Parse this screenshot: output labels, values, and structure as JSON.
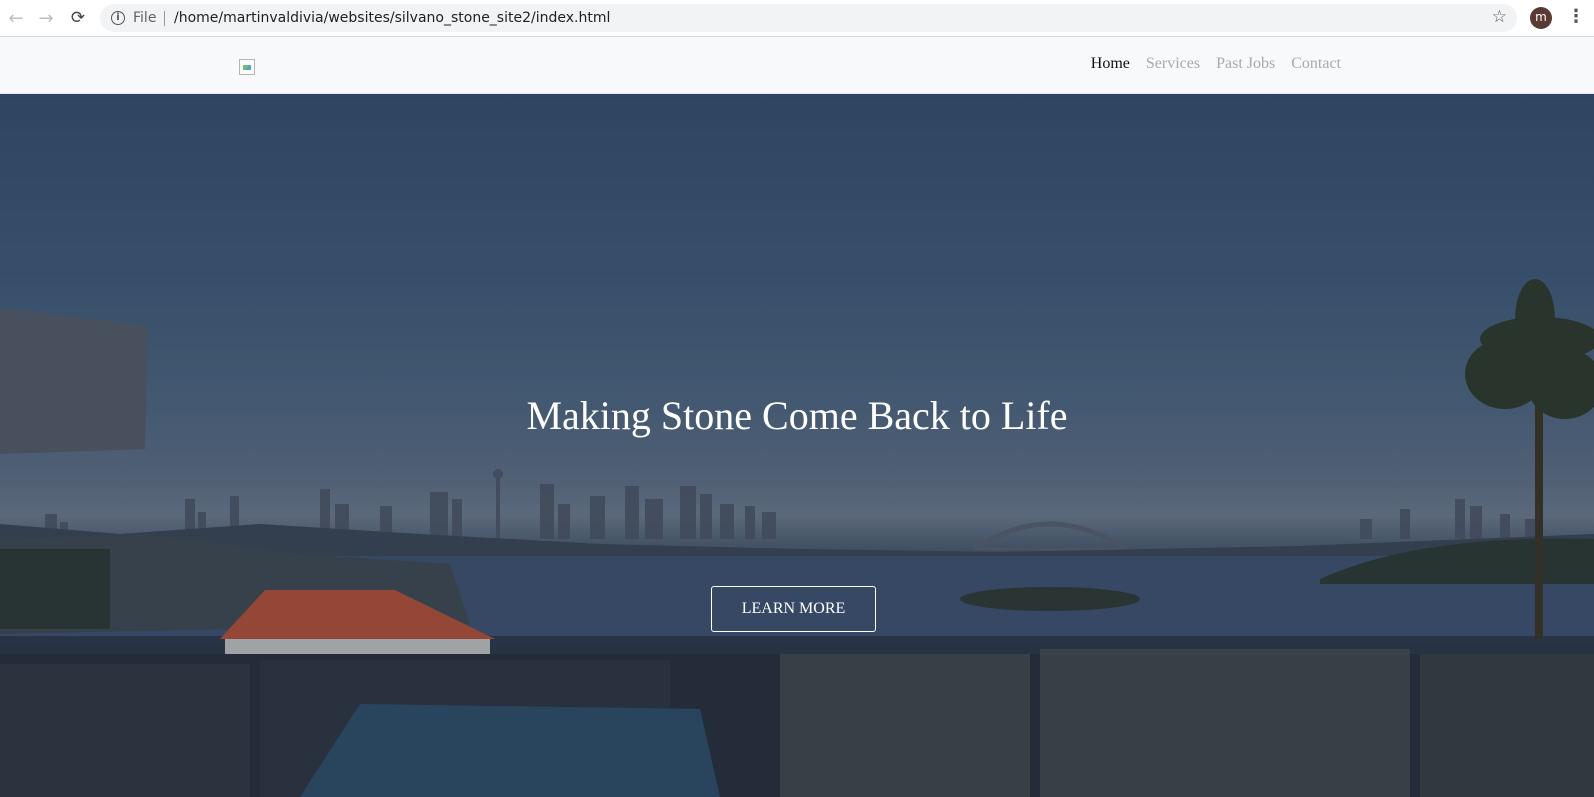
{
  "browser": {
    "back_icon": "arrow-left-icon",
    "forward_icon": "arrow-right-icon",
    "reload_icon": "reload-icon",
    "info_icon": "info-icon",
    "scheme": "File",
    "url": "/home/martinvaldivia/websites/silvano_stone_site2/index.html",
    "profile_initial": "m",
    "colors": {
      "avatar_bg": "#5a3a32",
      "omnibox_bg": "#f1f3f4"
    }
  },
  "navbar": {
    "logo_alt": "",
    "links": [
      {
        "label": "Home",
        "active": true
      },
      {
        "label": "Services",
        "active": false
      },
      {
        "label": "Past Jobs",
        "active": false
      },
      {
        "label": "Contact",
        "active": false
      }
    ],
    "colors": {
      "active": "#111111",
      "inactive": "#a9a9a9",
      "background": "#f8f9fa"
    }
  },
  "hero": {
    "title": "Making Stone Come Back to Life",
    "button_label": "LEARN MORE",
    "background_description_icon": "harbour-cityscape-image"
  }
}
